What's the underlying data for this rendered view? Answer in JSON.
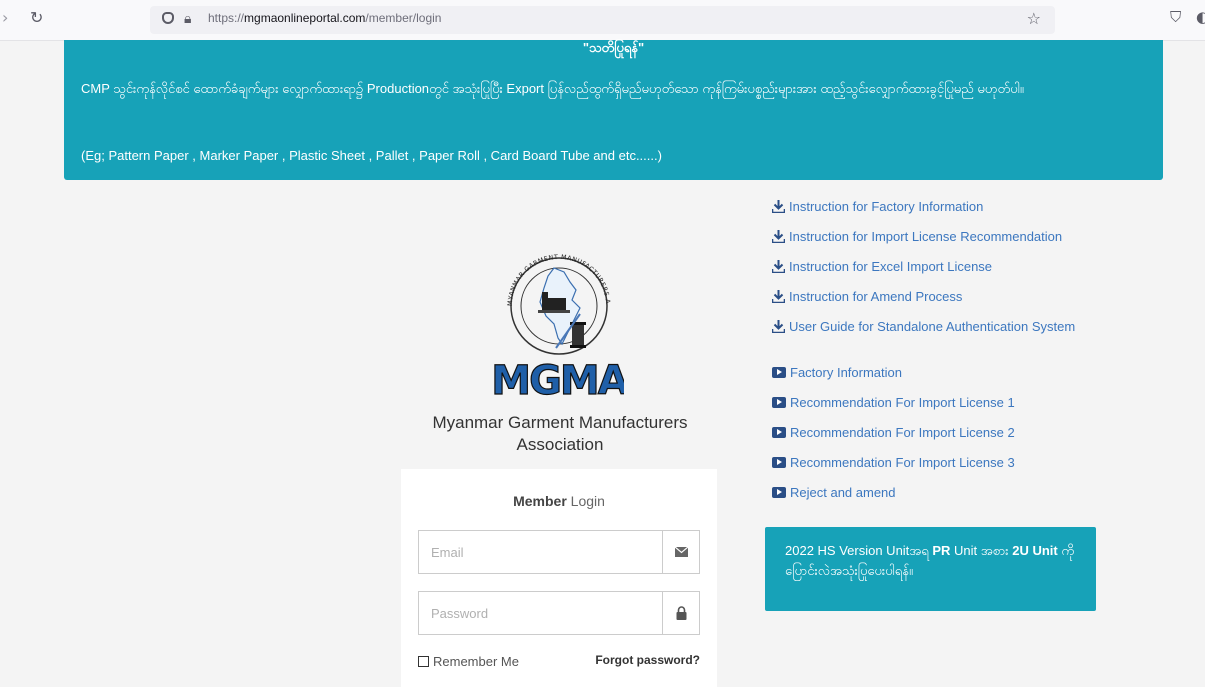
{
  "browser": {
    "url_scheme": "https://",
    "url_host": "mgmaonlineportal.com",
    "url_path": "/member/login"
  },
  "notice": {
    "heading": "\"သတိပြုရန်\"",
    "body": "CMP သွင်းကုန်လိုင်စင် ထောက်ခံချက်များ လျှောက်ထားရာ၌ Productionတွင် အသုံးပြုပြီး Export ပြန်လည်ထွက်ရှိမည်မဟုတ်သော ကုန်ကြမ်းပစ္စည်းများအား ထည့်သွင်းလျှောက်ထားခွင့်ပြုမည် မဟုတ်ပါ။",
    "example": "(Eg; Pattern Paper , Marker Paper , Plastic Sheet , Pallet , Paper Roll , Card Board Tube and etc......)"
  },
  "logo": {
    "text": "MGMA",
    "ring_text": "MYANMAR GARMENT MANUFACTURERS ASSOCIATION"
  },
  "org_name": "Myanmar Garment Manufacturers Association",
  "login": {
    "title_bold": "Member",
    "title_rest": " Login",
    "email_placeholder": "Email",
    "password_placeholder": "Password",
    "remember_label": "Remember Me",
    "forgot_label": "Forgot password?"
  },
  "instructions": [
    "Instruction for Factory Information",
    "Instruction for Import License Recommendation",
    "Instruction for Excel Import License",
    "Instruction for Amend Process",
    "User Guide for Standalone Authentication System"
  ],
  "videos": [
    "Factory Information",
    "Recommendation For Import License 1",
    "Recommendation For Import License 2",
    "Recommendation For Import License 3",
    "Reject and amend"
  ],
  "unit_note": {
    "part1": "2022 HS Version Unitအရ ",
    "bold1": "PR",
    "part2": " Unit အစား ",
    "bold2": "2U Unit",
    "part3": " ကို ပြောင်းလဲအသုံးပြုပေးပါရန်။"
  },
  "colors": {
    "teal": "#17a2b8",
    "link": "#3c77bf",
    "icon_dark": "#2a4e86"
  }
}
